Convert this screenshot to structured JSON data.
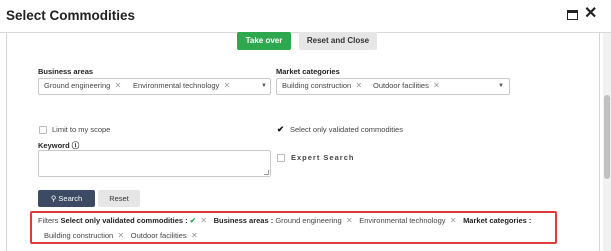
{
  "dialog": {
    "title": "Select Commodities",
    "maximize_icon": "window-maximize-icon",
    "close_icon": "close-icon"
  },
  "actions": {
    "take_over_label": "Take over",
    "reset_and_close_label": "Reset and Close"
  },
  "business_areas": {
    "label": "Business areas",
    "tags": [
      "Ground engineering",
      "Environmental technology"
    ]
  },
  "market_categories": {
    "label": "Market categories",
    "tags": [
      "Building construction",
      "Outdoor facilities"
    ]
  },
  "options": {
    "limit_scope_label": "Limit to my scope",
    "limit_scope_checked": false,
    "validated_label": "Select only validated commodities",
    "validated_checked": true,
    "expert_search_label": "Expert Search",
    "expert_search_checked": false
  },
  "keyword": {
    "label": "Keyword ⓘ",
    "value": ""
  },
  "search": {
    "search_label": "Search",
    "reset_label": "Reset"
  },
  "filters": {
    "prefix": "Filters",
    "validated_label": "Select only validated commodities :",
    "business_areas_label": "Business areas :",
    "business_areas": [
      "Ground engineering",
      "Environmental technology"
    ],
    "market_categories_label": "Market categories :",
    "market_categories": [
      "Building construction",
      "Outdoor facilities"
    ]
  },
  "colors": {
    "take_over": "#2ea84f",
    "search_button": "#3d4a63",
    "filter_highlight": "#e03a3a"
  }
}
